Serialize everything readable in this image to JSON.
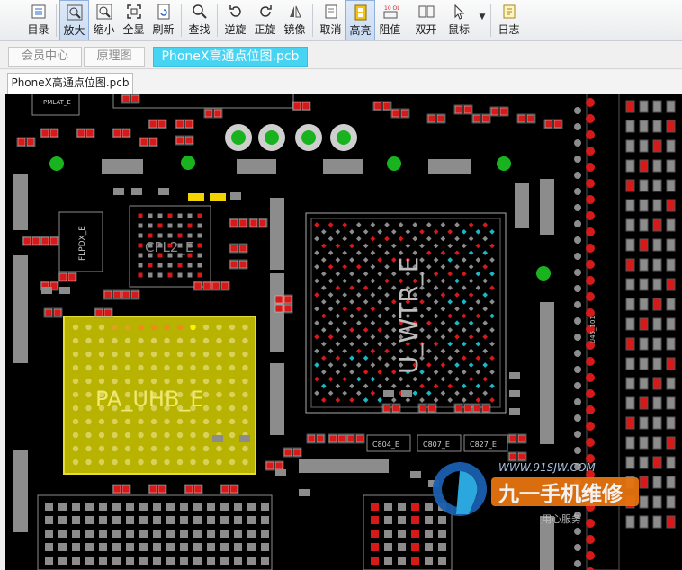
{
  "toolbar": {
    "buttons": [
      {
        "label": "目录",
        "icon": "outline-icon"
      },
      {
        "label": "放大",
        "icon": "zoom-in-icon"
      },
      {
        "label": "缩小",
        "icon": "zoom-out-icon"
      },
      {
        "label": "全显",
        "icon": "fit-all-icon"
      },
      {
        "label": "刷新",
        "icon": "refresh-icon"
      },
      {
        "label": "查找",
        "icon": "search-icon"
      },
      {
        "label": "逆旋",
        "icon": "rotate-ccw-icon"
      },
      {
        "label": "正旋",
        "icon": "rotate-cw-icon"
      },
      {
        "label": "镜像",
        "icon": "mirror-icon"
      },
      {
        "label": "取消",
        "icon": "cancel-icon"
      },
      {
        "label": "高亮",
        "icon": "highlight-icon"
      },
      {
        "label": "阻值",
        "icon": "resistance-icon"
      },
      {
        "label": "双开",
        "icon": "dual-open-icon"
      },
      {
        "label": "鼠标",
        "icon": "mouse-cursor-icon"
      },
      {
        "label": "日志",
        "icon": "log-icon"
      }
    ],
    "active_label": "高亮"
  },
  "nav_tabs": [
    {
      "label": "会员中心"
    },
    {
      "label": "原理图"
    },
    {
      "label": "PhoneX高通点位图.pcb"
    }
  ],
  "document_tab": "PhoneX高通点位图.pcb",
  "pcb": {
    "components": {
      "pa_uhb": "PA_UHB_E",
      "u_wtr": "U_WTR_E",
      "cpl2": "CPL2_E",
      "flpdx": "FLPDX_E",
      "pmlat": "PMLAT_E",
      "ref_tiny": "U45_101"
    },
    "cap_labels": [
      "C804_E",
      "C807_E",
      "C827_E"
    ],
    "watermark": {
      "url": "WWW.91SJW.COM",
      "brand": "九一手机维修",
      "slogan": "用心服务"
    },
    "colors": {
      "board": "#000000",
      "pad": "#8c8c8c",
      "red_pad": "#d61a1a",
      "highlight": "#b8b200",
      "cyan": "#1bb7c4",
      "green": "#19b31f"
    }
  }
}
